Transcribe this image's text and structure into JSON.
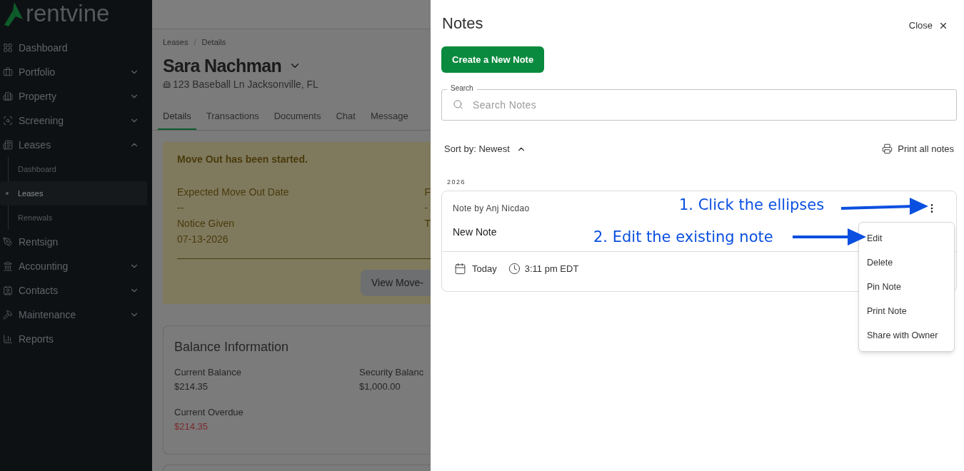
{
  "sidebar": {
    "logo": "rentvine",
    "items": [
      {
        "label": "Dashboard",
        "kind": "link"
      },
      {
        "label": "Portfolio",
        "kind": "group",
        "expanded": false
      },
      {
        "label": "Property",
        "kind": "group",
        "expanded": false
      },
      {
        "label": "Screening",
        "kind": "group",
        "expanded": false
      },
      {
        "label": "Leases",
        "kind": "group",
        "expanded": true,
        "children": [
          {
            "label": "Dashboard",
            "selected": false
          },
          {
            "label": "Leases",
            "selected": true
          },
          {
            "label": "Renewals",
            "selected": false
          }
        ]
      },
      {
        "label": "Rentsign",
        "kind": "link"
      },
      {
        "label": "Accounting",
        "kind": "group",
        "expanded": false
      },
      {
        "label": "Contacts",
        "kind": "group",
        "expanded": false
      },
      {
        "label": "Maintenance",
        "kind": "group",
        "expanded": false
      },
      {
        "label": "Reports",
        "kind": "link"
      }
    ]
  },
  "main": {
    "breadcrumb": [
      "Leases",
      "Details"
    ],
    "breadcrumb_separator": "/",
    "title": "Sara Nachman",
    "address": "123 Baseball Ln Jacksonville, FL",
    "tabs": [
      {
        "label": "Details",
        "selected": true
      },
      {
        "label": "Transactions",
        "selected": false
      },
      {
        "label": "Documents",
        "selected": false
      },
      {
        "label": "Chat",
        "selected": false
      },
      {
        "label": "Message",
        "selected": false
      }
    ],
    "alert": {
      "title": "Move Out has been started.",
      "column_1": [
        {
          "label": "Expected Move Out Date",
          "value": "--"
        },
        {
          "label": "Notice Given",
          "value": "07-13-2026"
        }
      ],
      "column_2": [
        {
          "label": "F",
          "value": "-"
        },
        {
          "label": "T"
        }
      ],
      "button": "View Move-"
    },
    "balance": {
      "title": "Balance Information",
      "fields": [
        {
          "label": "Current Balance",
          "value": "$214.35",
          "overdue": false
        },
        {
          "label": "Security Balanc",
          "value": "$1,000.00",
          "overdue": false
        },
        {
          "label": "Current Overdue",
          "value": "$214.35",
          "overdue": true
        }
      ]
    }
  },
  "notes_panel": {
    "title": "Notes",
    "close": "Close",
    "create_button": "Create a New Note",
    "search": {
      "label": "Search",
      "placeholder": "Search Notes"
    },
    "sort": "Sort by: Newest",
    "print_all": "Print all notes",
    "groups": [
      {
        "year": "2026",
        "notes": [
          {
            "author": "Note by Anj Nicdao",
            "body": "New Note",
            "date": "Today",
            "time": "3:11 pm EDT"
          }
        ]
      }
    ],
    "menu": [
      "Edit",
      "Delete",
      "Pin Note",
      "Print Note",
      "Share with Owner"
    ],
    "annotations": [
      "1. Click the ellipses",
      "2. Edit the existing note"
    ]
  }
}
